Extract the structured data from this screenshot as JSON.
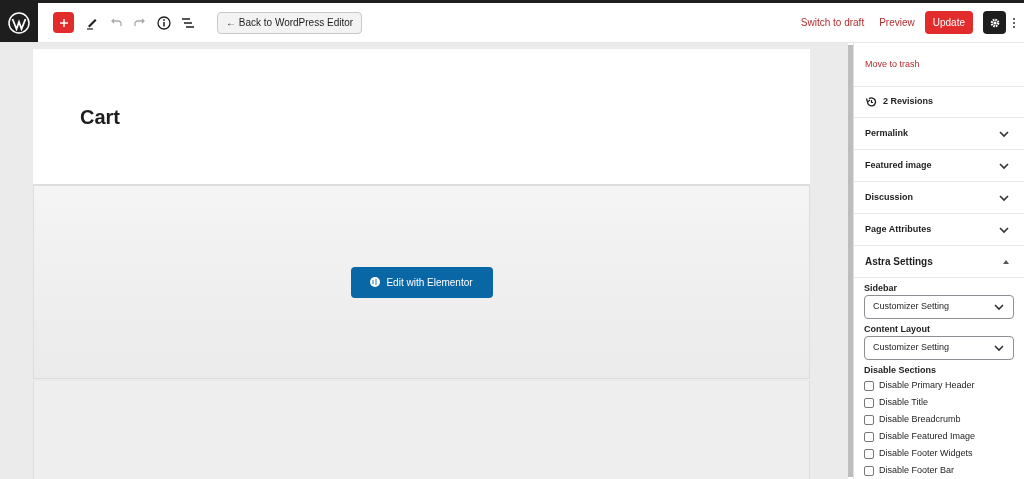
{
  "toolbar": {
    "back_button": "← Back to WordPress Editor",
    "switch_to_draft": "Switch to draft",
    "preview": "Preview",
    "update": "Update",
    "settings_selected": true
  },
  "page": {
    "title": "Cart",
    "elementor_button": "Edit with Elementor"
  },
  "sidebar": {
    "move_to_trash": "Move to trash",
    "revisions": "2 Revisions",
    "panels": [
      {
        "label": "Permalink",
        "expanded": false
      },
      {
        "label": "Featured image",
        "expanded": false
      },
      {
        "label": "Discussion",
        "expanded": false
      },
      {
        "label": "Page Attributes",
        "expanded": false
      },
      {
        "label": "Astra Settings",
        "expanded": true
      }
    ],
    "astra": {
      "fields": [
        {
          "label": "Sidebar",
          "value": "Customizer Setting"
        },
        {
          "label": "Content Layout",
          "value": "Customizer Setting"
        }
      ],
      "disable_sections_label": "Disable Sections",
      "checkboxes": [
        {
          "label": "Disable Primary Header",
          "checked": false
        },
        {
          "label": "Disable Title",
          "checked": false
        },
        {
          "label": "Disable Breadcrumb",
          "checked": false
        },
        {
          "label": "Disable Featured Image",
          "checked": false
        },
        {
          "label": "Disable Footer Widgets",
          "checked": false
        },
        {
          "label": "Disable Footer Bar",
          "checked": false
        }
      ]
    }
  }
}
